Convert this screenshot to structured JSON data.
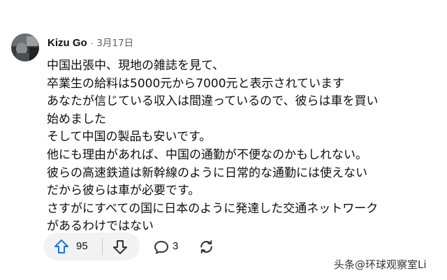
{
  "comment": {
    "author": "Kizu Go",
    "separator": "·",
    "date": "3月17日",
    "lines": [
      "中国出張中、現地の雑誌を見て、",
      "卒業生の給料は5000元から7000元と表示されています",
      "あなたが信じている収入は間違っているので、彼らは車を買い",
      "始めました",
      "そして中国の製品も安いです。",
      "他にも理由があれば、中国の通勤が不便なのかもしれない。",
      "彼らの高速鉄道は新幹線のように日常的な通勤には使えない",
      "だから彼らは車が必要です。",
      "さすがにすべての国に日本のように発達した交通ネットワーク",
      "があるわけではない"
    ]
  },
  "actions": {
    "like_count": "95",
    "reply_count": "3",
    "like_icon": "thumb-up-arrow-icon",
    "dislike_icon": "thumb-down-arrow-icon",
    "reply_icon": "comment-bubble-icon",
    "share_icon": "repost-refresh-icon"
  },
  "watermark": {
    "platform": "头条",
    "account": "@环球观察室Li"
  },
  "colors": {
    "accent_blue": "#1a73e8",
    "text_primary": "#0f0f0f",
    "text_secondary": "#606060",
    "pill_bg": "#f2f2f2",
    "icon_gray": "#333333"
  }
}
